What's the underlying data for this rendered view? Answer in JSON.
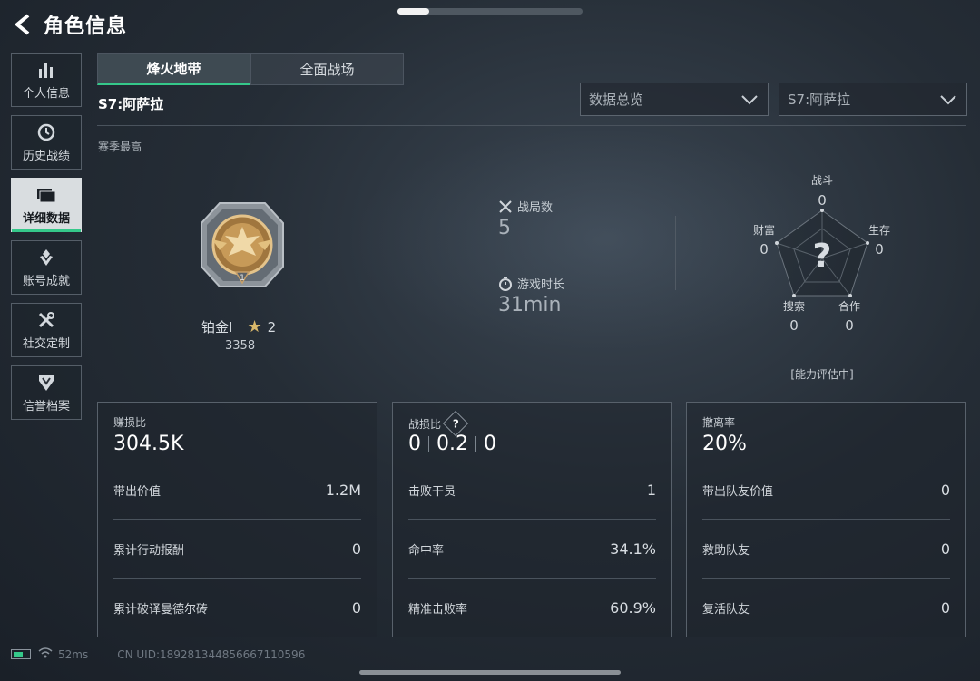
{
  "header": {
    "title": "角色信息"
  },
  "progress_indicator": 0.17,
  "sidebar": {
    "items": [
      {
        "label": "个人信息",
        "icon": "bar-chart-icon",
        "active": false
      },
      {
        "label": "历史战绩",
        "icon": "clock-icon",
        "active": false
      },
      {
        "label": "详细数据",
        "icon": "folder-icon",
        "active": true
      },
      {
        "label": "账号成就",
        "icon": "achievement-icon",
        "active": false
      },
      {
        "label": "社交定制",
        "icon": "tools-icon",
        "active": false
      },
      {
        "label": "信誉档案",
        "icon": "shield-icon",
        "active": false
      }
    ]
  },
  "tabs": [
    {
      "label": "烽火地带",
      "active": true
    },
    {
      "label": "全面战场",
      "active": false
    }
  ],
  "season": {
    "label": "S7:阿萨拉"
  },
  "filters": {
    "view": "数据总览",
    "season": "S7:阿萨拉"
  },
  "rank": {
    "section_label": "赛季最高",
    "name": "铂金Ⅰ",
    "stars": "2",
    "score": "3358"
  },
  "match_stats": {
    "matches_label": "战局数",
    "matches_value": "5",
    "playtime_label": "游戏时长",
    "playtime_value": "31min"
  },
  "radar": {
    "labels": {
      "combat": "战斗",
      "survival": "生存",
      "cooperation": "合作",
      "search": "搜索",
      "wealth": "财富"
    },
    "values": {
      "combat": "0",
      "survival": "0",
      "cooperation": "0",
      "search": "0",
      "wealth": "0"
    },
    "center": "?",
    "status": "[能力评估中]"
  },
  "cards": {
    "profit": {
      "title": "赚损比",
      "value": "304.5K",
      "rows": [
        {
          "label": "带出价值",
          "value": "1.2M"
        },
        {
          "label": "累计行动报酬",
          "value": "0"
        },
        {
          "label": "累计破译曼德尔砖",
          "value": "0"
        }
      ]
    },
    "combat": {
      "title": "战损比",
      "help": "?",
      "kda": [
        "0",
        "0.2",
        "0"
      ],
      "rows": [
        {
          "label": "击败干员",
          "value": "1"
        },
        {
          "label": "命中率",
          "value": "34.1%"
        },
        {
          "label": "精准击败率",
          "value": "60.9%"
        }
      ]
    },
    "extract": {
      "title": "撤离率",
      "value": "20%",
      "rows": [
        {
          "label": "带出队友价值",
          "value": "0"
        },
        {
          "label": "救助队友",
          "value": "0"
        },
        {
          "label": "复活队友",
          "value": "0"
        }
      ]
    }
  },
  "footer": {
    "ping": "52ms",
    "uid": "CN UID:1892813448566671105​96"
  },
  "colors": {
    "accent": "#35c88a",
    "rank_gold": "#d9b86a"
  }
}
